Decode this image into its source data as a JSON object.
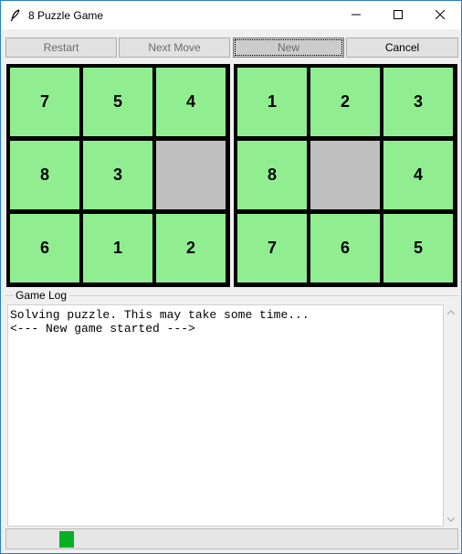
{
  "window": {
    "title": "8 Puzzle Game"
  },
  "toolbar": {
    "restart_label": "Restart",
    "next_move_label": "Next Move",
    "new_label": "New",
    "cancel_label": "Cancel"
  },
  "board_left": {
    "tiles": [
      "7",
      "5",
      "4",
      "8",
      "3",
      "",
      "6",
      "1",
      "2"
    ]
  },
  "board_right": {
    "tiles": [
      "1",
      "2",
      "3",
      "8",
      "",
      "4",
      "7",
      "6",
      "5"
    ]
  },
  "log": {
    "label": "Game Log",
    "lines": [
      "Solving puzzle. This may take some time...",
      "<--- New game started --->"
    ]
  },
  "status": {
    "progress_color": "#06b025"
  },
  "colors": {
    "tile": "#90ee90",
    "empty_tile": "#c0c0c0"
  }
}
